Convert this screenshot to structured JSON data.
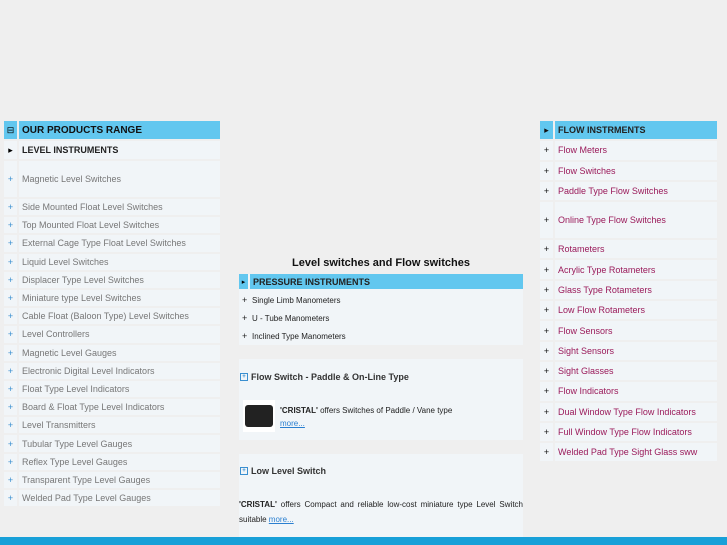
{
  "left": {
    "header": "OUR PRODUCTS RANGE",
    "sub": "LEVEL INSTRUMENTS",
    "items": [
      "Magnetic Level Switches",
      "Side Mounted Float Level Switches",
      "Top Mounted Float Level Switches",
      "External Cage Type Float Level Switches",
      "Liquid Level Switches",
      "Displacer Type Level Switches",
      "Miniature type Level Switches",
      "Cable Float (Baloon Type) Level Switches",
      "Level Controllers",
      "Magnetic Level Gauges",
      "Electronic Digital Level Indicators",
      "Float Type Level Indicators",
      "Board & Float Type Level Indicators",
      "Level Transmitters",
      "Tubular Type Level Gauges",
      "Reflex Type Level Gauges",
      "Transparent Type Level Gauges",
      "Welded Pad Type Level Gauges"
    ]
  },
  "center": {
    "title": "Level switches and Flow switches",
    "pressure": {
      "header": "PRESSURE INSTRUMENTS",
      "items": [
        "Single Limb Manometers",
        "U - Tube Manometers",
        "Inclined Type Manometers"
      ]
    },
    "flow_box": {
      "title": "Flow Switch - Paddle & On-Line Type",
      "brand": "'CRISTAL'",
      "text": " offers  Switches of Paddle / Vane type",
      "more": "more..."
    },
    "low_box": {
      "title": "Low Level Switch",
      "brand": "'CRISTAL'",
      "text": " offers Compact and reliable low-cost miniature type Level Switch suitable ",
      "more": "more..."
    }
  },
  "right": {
    "header": "FLOW INSTRMENTS",
    "items": [
      "Flow Meters",
      "Flow Switches",
      "Paddle Type Flow Switches",
      "Online Type Flow Switches",
      "Rotameters",
      "Acrylic Type Rotameters",
      "Glass Type Rotameters",
      "Low Flow Rotameters",
      "Flow Sensors",
      "Sight Sensors",
      "Sight Glasses",
      "Flow Indicators",
      "Dual Window Type Flow Indicators",
      "Full Window Type Flow Indicators",
      "Welded Pad Type Sight Glass sww"
    ]
  }
}
